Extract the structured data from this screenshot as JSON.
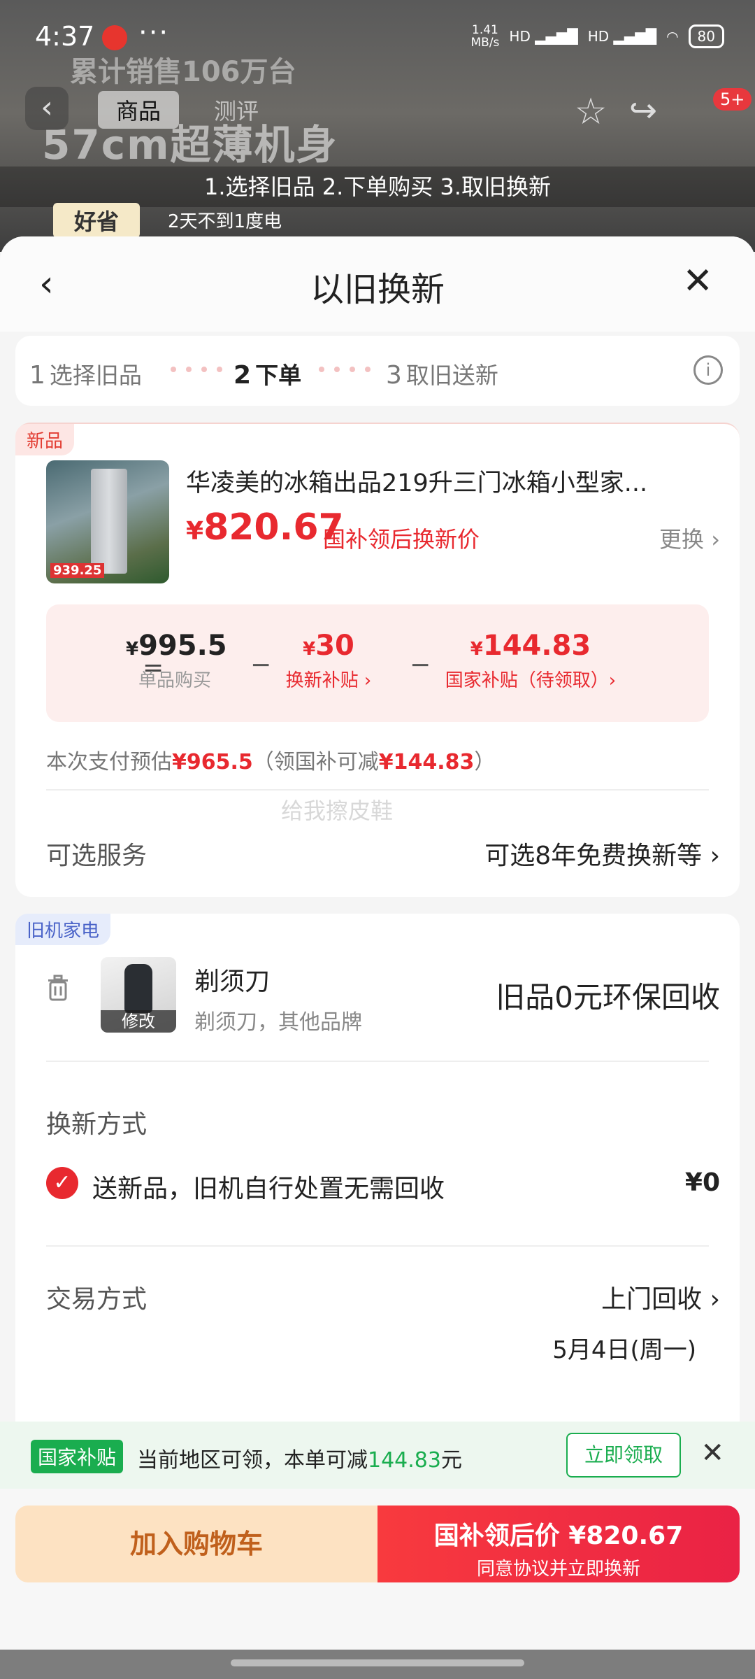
{
  "status_bar": {
    "time": "4:37",
    "dots": "···",
    "net_speed_top": "1.41",
    "net_speed_bottom": "MB/s",
    "signal1": "HD",
    "signal2": "HD",
    "battery": "80"
  },
  "background_page": {
    "headline": "57cm超薄机身",
    "headline2": "累计销售106万台",
    "tabs": [
      "商品",
      "测评"
    ],
    "badge": "5+",
    "instruction": "1.选择旧品 2.下单购买 3.取旧换新",
    "tag_good": "好省",
    "tag_good_desc": "2天不到1度电"
  },
  "sheet": {
    "title": "以旧换新",
    "back_icon": "‹",
    "close_icon": "✕"
  },
  "steps": [
    {
      "num": "1",
      "label": "选择旧品"
    },
    {
      "num": "2",
      "label": "下单"
    },
    {
      "num": "3",
      "label": "取旧送新"
    }
  ],
  "new_product": {
    "tag": "新品",
    "name": "华凌美的冰箱出品219升三门冰箱小型家...",
    "image_price": "939.25",
    "currency": "¥",
    "price": "820.67",
    "price_label": "国补领后换新价",
    "change_label": "更换 ›",
    "calc": {
      "equals": "=",
      "unit_price": "995.5",
      "unit_price_label": "单品购买",
      "trade_in": "30",
      "trade_in_label": "换新补贴 ›",
      "national": "144.83",
      "national_label": "国家补贴（待领取）›",
      "minus": "−"
    },
    "pay_estimate_prefix": "本次支付预估",
    "pay_estimate_value": "¥965.5",
    "pay_estimate_mid": "（领国补可减",
    "pay_estimate_reduce": "¥144.83",
    "pay_estimate_suffix": "）",
    "watermark": "给我擦皮鞋",
    "service_label": "可选服务",
    "service_value": "可选8年免费换新等 ›"
  },
  "old_appliance": {
    "tag": "旧机家电",
    "edit_label": "修改",
    "name": "剃须刀",
    "desc": "剃须刀，其他品牌",
    "recycle": "旧品0元环保回收",
    "method_title": "换新方式",
    "method_text": "送新品，旧机自行处置无需回收",
    "method_price": "¥0",
    "trade_label": "交易方式",
    "trade_value": "上门回收 ›",
    "trade_date": "5月4日(周一)"
  },
  "subsidy": {
    "tag": "国家补贴",
    "text_prefix": "当前地区可领，本单可减",
    "amount": "144.83",
    "text_suffix": "元",
    "claim_button": "立即领取",
    "close_icon": "✕"
  },
  "bottom": {
    "add_cart": "加入购物车",
    "buy_line1": "国补领后价 ¥820.67",
    "buy_line2": "同意协议并立即换新"
  },
  "colors": {
    "accent_red": "#e8292f",
    "green": "#1aad4f",
    "blue_tag": "#4a63c8"
  }
}
